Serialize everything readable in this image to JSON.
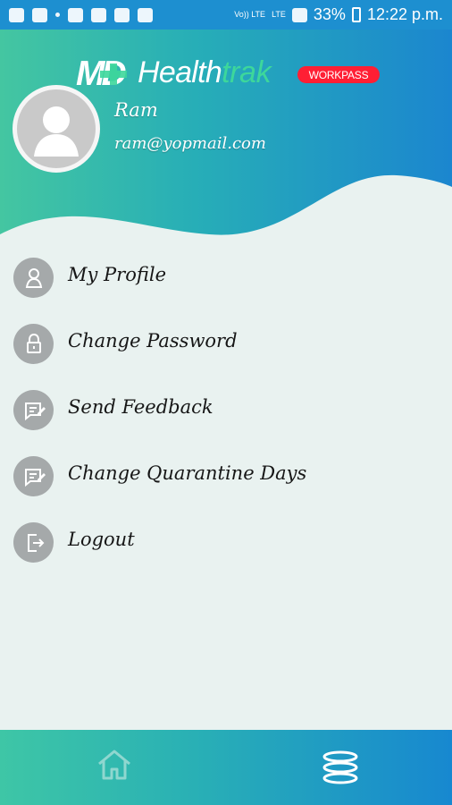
{
  "status_bar": {
    "network_top": "Vo)) LTE",
    "network_small": "LTE",
    "battery": "33%",
    "time": "12:22 p.m."
  },
  "header": {
    "logo_prefix": "MD",
    "logo_health": "Health",
    "logo_trak": "trak",
    "workpass": "WORKPASS",
    "user_name": "Ram",
    "user_email": "ram@yopmail.com"
  },
  "menu": {
    "items": [
      {
        "label": "My Profile",
        "icon": "user-icon"
      },
      {
        "label": "Change Password",
        "icon": "lock-icon"
      },
      {
        "label": "Send Feedback",
        "icon": "feedback-icon"
      },
      {
        "label": "Change Quarantine Days",
        "icon": "edit-calendar-icon"
      },
      {
        "label": "Logout",
        "icon": "logout-icon"
      }
    ]
  },
  "bottom_nav": {
    "home_icon": "home-icon",
    "menu_icon": "menu-icon"
  },
  "colors": {
    "teal": "#44c6a1",
    "blue": "#1b86cf",
    "accent_green": "#3dd79b",
    "badge_red": "#ff1f34",
    "menu_icon_gray": "#a5a9aa",
    "menu_background": "#e9f2f0"
  }
}
